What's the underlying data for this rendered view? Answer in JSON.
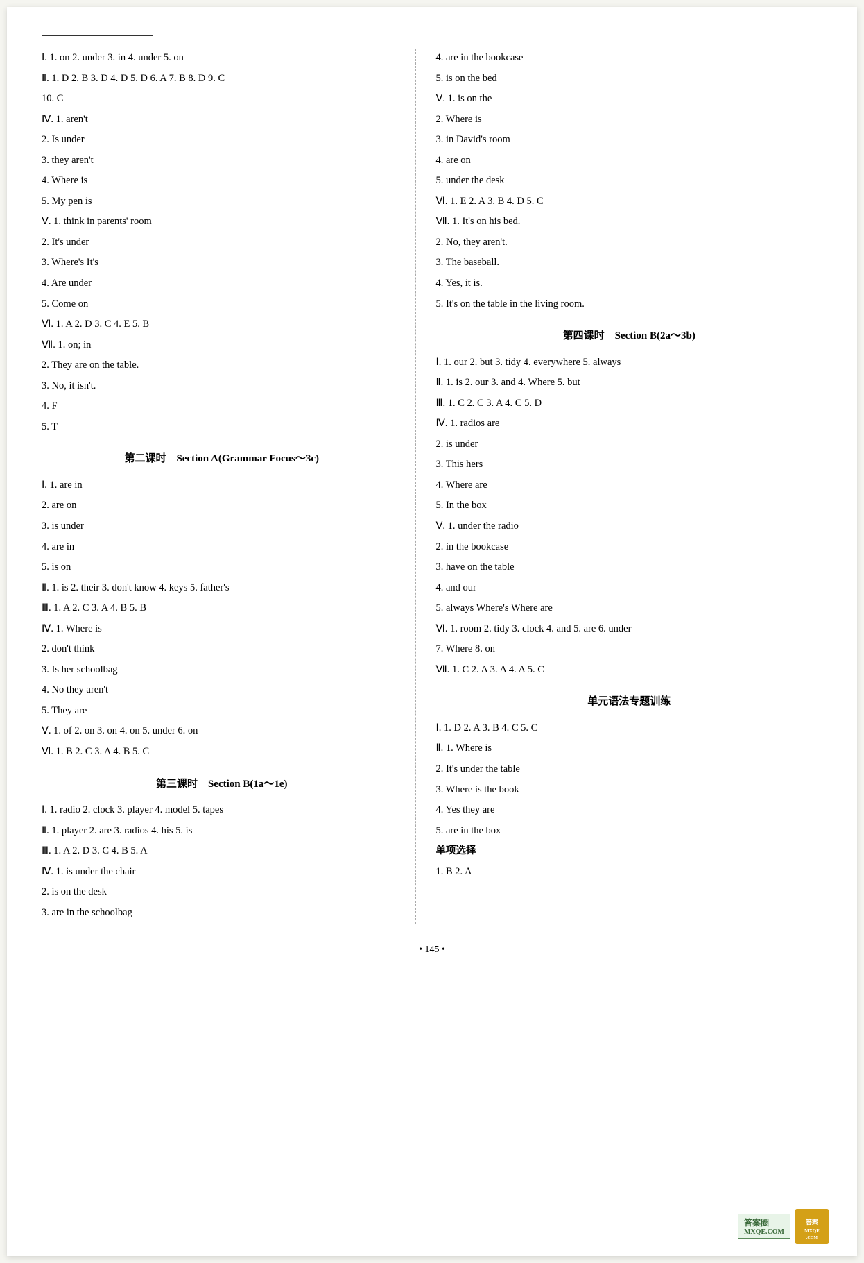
{
  "page": {
    "top_line": true,
    "left_column": {
      "sections": [
        {
          "id": "left-section-1",
          "lines": [
            "Ⅰ. 1. on  2. under  3. in  4. under  5. on",
            "Ⅱ. 1. D  2. B  3. D  4. D  5. D  6. A  7. B  8. D  9. C",
            "10. C",
            "Ⅳ. 1. aren't",
            "2. Is  under",
            "3. they  aren't",
            "4. Where   is",
            "5. My  pen  is",
            "Ⅴ. 1. think  in  parents'  room",
            "2. It's  under",
            "3. Where's  It's",
            "4. Are  under",
            "5. Come  on",
            "Ⅵ. 1. A  2. D  3. C  4. E  5. B",
            "Ⅶ. 1. on; in",
            "2. They are on the table.",
            "3. No, it isn't.",
            "4. F",
            "5. T"
          ]
        },
        {
          "id": "left-section-2",
          "header": "第二课时    Section A(Grammar Focus～3c)",
          "lines": [
            "Ⅰ. 1. are  in",
            "2. are  on",
            "3. is  under",
            "4. are  in",
            "5. is  on",
            "Ⅱ. 1. is  2. their  3. don't  know  4. keys  5. father's",
            "Ⅲ. 1. A  2. C  3. A  4. B  5. B",
            "Ⅳ. 1. Where   is",
            "2. don't  think",
            "3. Is  her  schoolbag",
            "4. No  they  aren't",
            "5. They  are",
            "Ⅴ. 1. of  2. on  3. on  4. on  5. under  6. on",
            "Ⅵ. 1. B  2. C  3. A  4. B  5. C"
          ]
        },
        {
          "id": "left-section-3",
          "header": "第三课时    Section B(1a～1e)",
          "lines": [
            "Ⅰ. 1. radio  2. clock  3. player  4. model  5. tapes",
            "Ⅱ. 1. player  2. are  3. radios  4. his  5. is",
            "Ⅲ. 1. A  2. D  3. C  4. B  5. A",
            "Ⅳ. 1. is under the chair",
            "2. is on the desk",
            "3. are in the schoolbag"
          ]
        }
      ]
    },
    "right_column": {
      "sections": [
        {
          "id": "right-section-1",
          "lines": [
            "4. are in the bookcase",
            "5. is on the bed",
            "Ⅴ. 1. is   on  the",
            "2. Where   is",
            "3. in  David's  room",
            "4. are  on",
            "5. under  the desk",
            "Ⅵ. 1. E  2. A  3. B  4. D  5. C",
            "Ⅶ. 1. It's on his bed.",
            "2. No, they aren't.",
            "3. The baseball.",
            "4. Yes, it is.",
            "5. It's on the table in the living room."
          ]
        },
        {
          "id": "right-section-2",
          "header": "第四课时    Section B(2a～3b)",
          "lines": [
            "Ⅰ. 1. our  2. but  3. tidy  4. everywhere  5. always",
            "Ⅱ. 1. is  2. our  3. and  4. Where  5. but",
            "Ⅲ. 1. C  2. C  3. A  4. C  5. D",
            "Ⅳ. 1. radios  are",
            "2. is  under",
            "3. This  hers",
            "4. Where  are",
            "5. In  the  box",
            "Ⅴ. 1. under  the  radio",
            "2. in  the  bookcase",
            "3. have  on  the  table",
            "4. and  our",
            "5. always  Where's  Where  are",
            "Ⅵ. 1. room  2. tidy  3. clock  4. and  5. are  6. under",
            "7. Where  8. on",
            "Ⅶ. 1. C  2. A  3. A  4. A  5. C"
          ]
        },
        {
          "id": "right-section-3",
          "header": "单元语法专题训练",
          "lines": [
            "Ⅰ. 1. D  2. A  3. B  4. C  5. C",
            "Ⅱ. 1. Where  is",
            "2. It's  under  the  table",
            "3. Where  is  the  book",
            "4. Yes  they  are",
            "5. are  in  the  box",
            "单项选择",
            "1. B  2. A"
          ]
        }
      ]
    },
    "page_number": "• 145 •",
    "watermark_text": "答案圈",
    "watermark_site": "MXQE.COM"
  }
}
